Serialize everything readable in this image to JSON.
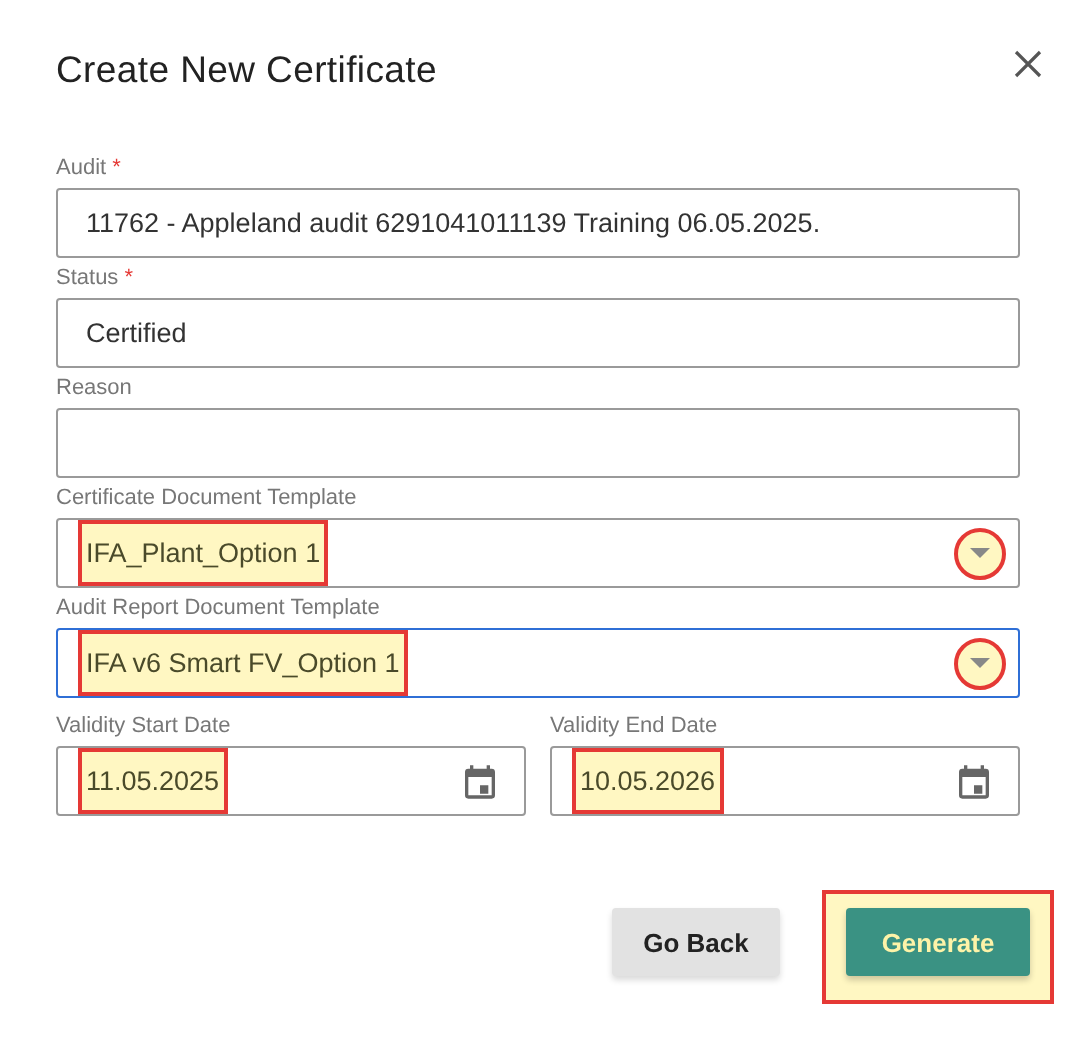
{
  "dialog": {
    "title": "Create New Certificate"
  },
  "fields": [
    {
      "kind": "text",
      "label": "Audit",
      "required_mark": "*",
      "value": "11762 - Appleland audit 6291041011139 Training 06.05.2025.",
      "focused": false
    },
    {
      "kind": "text",
      "label": "Status",
      "required_mark": "*",
      "value": "Certified",
      "focused": false
    },
    {
      "kind": "text",
      "label": "Reason",
      "focused": false
    },
    {
      "kind": "select",
      "label": "Certificate Document Template",
      "value": "IFA_Plant_Option 1",
      "focused": false,
      "highlighted": true,
      "arrow_highlighted": true
    },
    {
      "kind": "select",
      "label": "Audit Report Document Template",
      "value": "IFA v6 Smart FV_Option 1",
      "focused": true,
      "highlighted": true,
      "arrow_highlighted": true
    }
  ],
  "date_fields": [
    {
      "kind": "date",
      "label": "Validity Start Date",
      "value": "11.05.2025",
      "focused": false,
      "highlighted": true
    },
    {
      "kind": "date",
      "label": "Validity End Date",
      "value": "10.05.2026",
      "focused": false,
      "highlighted": true
    }
  ],
  "buttons": [
    {
      "kind": "secondary",
      "label": "Go Back",
      "highlighted": false
    },
    {
      "kind": "primary",
      "label": "Generate",
      "highlighted": true
    }
  ]
}
